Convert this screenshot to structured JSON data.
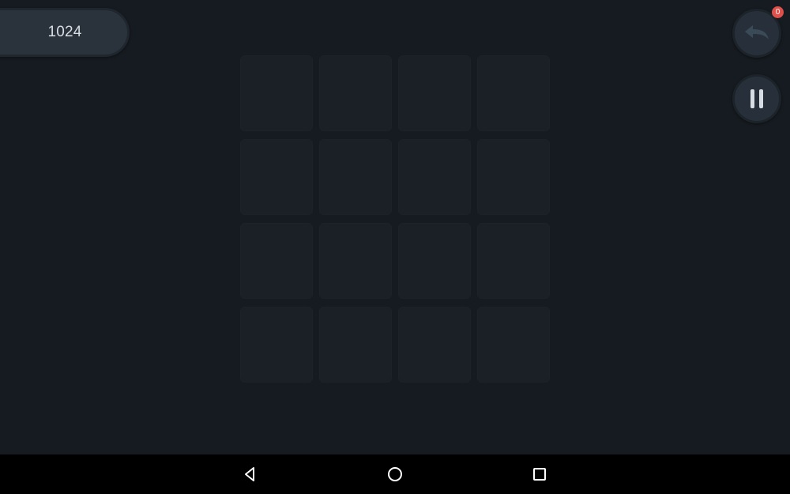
{
  "score": {
    "value": "1024"
  },
  "undo": {
    "icon": "undo-arrow-icon",
    "badge_count": "0",
    "badge_color": "#e0504a"
  },
  "pause": {
    "icon": "pause-icon"
  },
  "board": {
    "rows": 4,
    "columns": 4,
    "cells": [
      [
        "",
        "",
        "",
        ""
      ],
      [
        "",
        "",
        "",
        ""
      ],
      [
        "",
        "",
        "",
        ""
      ],
      [
        "",
        "",
        "",
        ""
      ]
    ]
  },
  "navigation_bar": {
    "buttons": [
      "back-triangle-icon",
      "home-circle-icon",
      "recents-square-icon"
    ]
  },
  "colors": {
    "background": "#161b21",
    "panel": "#2a333c",
    "empty_cell": "#1a2026",
    "navbar": "#000000"
  }
}
